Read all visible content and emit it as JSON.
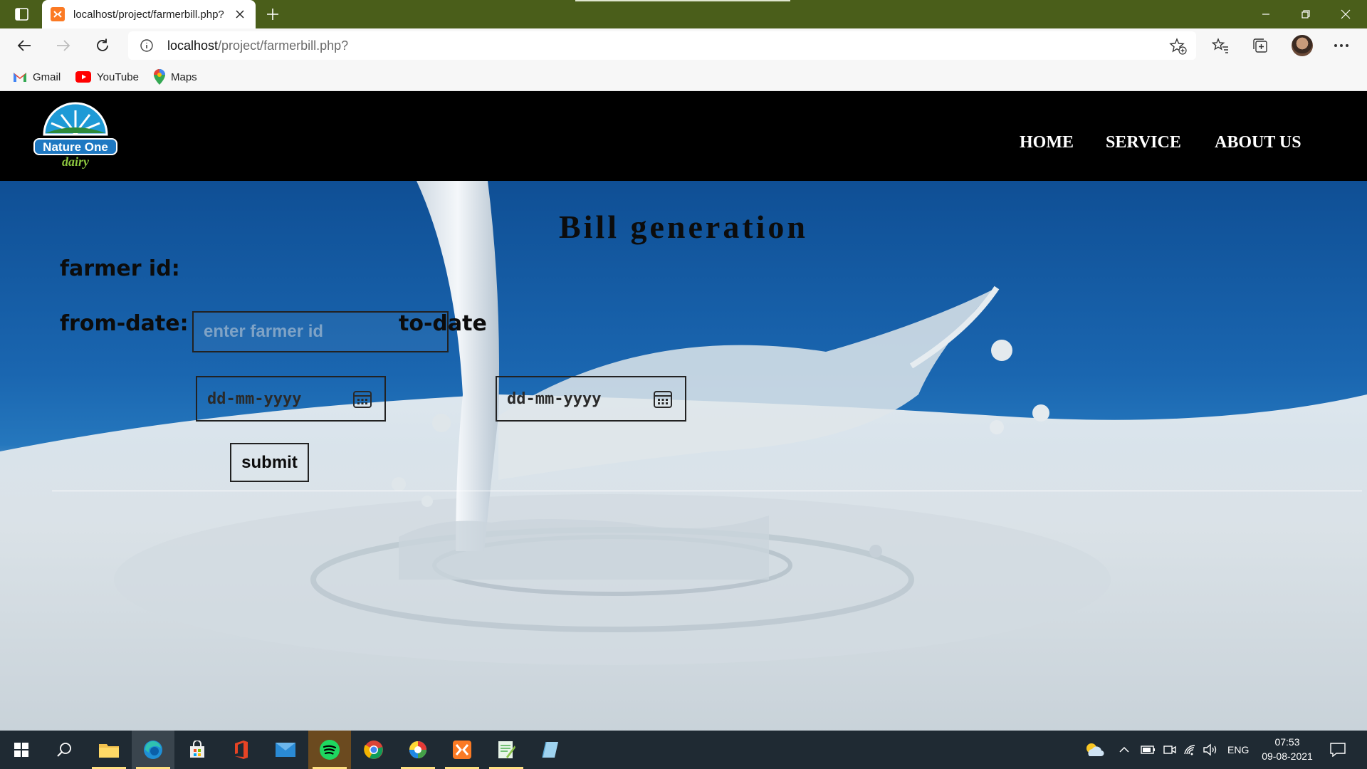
{
  "browser": {
    "tab_title": "localhost/project/farmerbill.php?",
    "url_host": "localhost",
    "url_path": "/project/farmerbill.php?",
    "bookmarks": [
      "Gmail",
      "YouTube",
      "Maps"
    ]
  },
  "site": {
    "logo_text": "Nature One",
    "logo_subtext": "dairy",
    "nav": [
      "HOME",
      "SERVICE",
      "ABOUT US"
    ]
  },
  "form": {
    "title": "Bill generation",
    "farmer_id_label": "farmer id:",
    "farmer_id_placeholder": "enter farmer id",
    "from_date_label": "from-date:",
    "from_date_value": "dd-mm-yyyy",
    "to_date_label": "to-date",
    "to_date_value": "dd-mm-yyyy",
    "submit_label": "submit"
  },
  "taskbar": {
    "language": "ENG",
    "time": "07:53",
    "date": "09-08-2021"
  },
  "colors": {
    "titlebar": "#4a5e1a",
    "header_bg": "#000000",
    "hero_blue": "#1a66b0",
    "taskbar": "#1f2a33"
  }
}
